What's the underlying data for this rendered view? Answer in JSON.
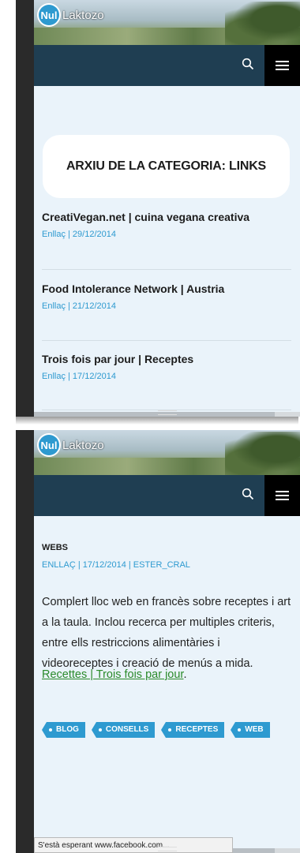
{
  "site": {
    "logo_badge": "Nul",
    "logo_text": "Laktozo"
  },
  "screen1": {
    "category_title": "ARXIU DE LA CATEGORIA: LINKS",
    "posts": [
      {
        "title": "CreatiVegan.net | cuina vegana creativa",
        "meta": "Enllaç | 29/12/2014"
      },
      {
        "title": "Food Intolerance Network | Austria",
        "meta": "Enllaç | 21/12/2014"
      },
      {
        "title": "Trois fois par jour | Receptes",
        "meta": "Enllaç | 17/12/2014"
      }
    ]
  },
  "screen2": {
    "category": "WEBS",
    "meta": "ENLLAÇ | 17/12/2014 | ESTER_CRAL",
    "body": "Complert lloc web en francès sobre receptes i art a la taula.  Inclou recerca per multiples criteris, entre ells restriccions alimentàries i videoreceptes i creació de menús a mida.",
    "link_text": "Recettes | Trois fois par jour",
    "link_suffix": ".",
    "tags": [
      "BLOG",
      "CONSELLS",
      "RECEPTES",
      "WEB"
    ],
    "status_text": "S'està esperant www.facebook.com..."
  },
  "icons": {
    "search": "search-icon",
    "menu": "hamburger-menu-icon"
  },
  "colors": {
    "navbar": "#1f3e52",
    "accent": "#2e9ad0",
    "background": "#eaf3fa",
    "link": "#2a8a2a"
  }
}
